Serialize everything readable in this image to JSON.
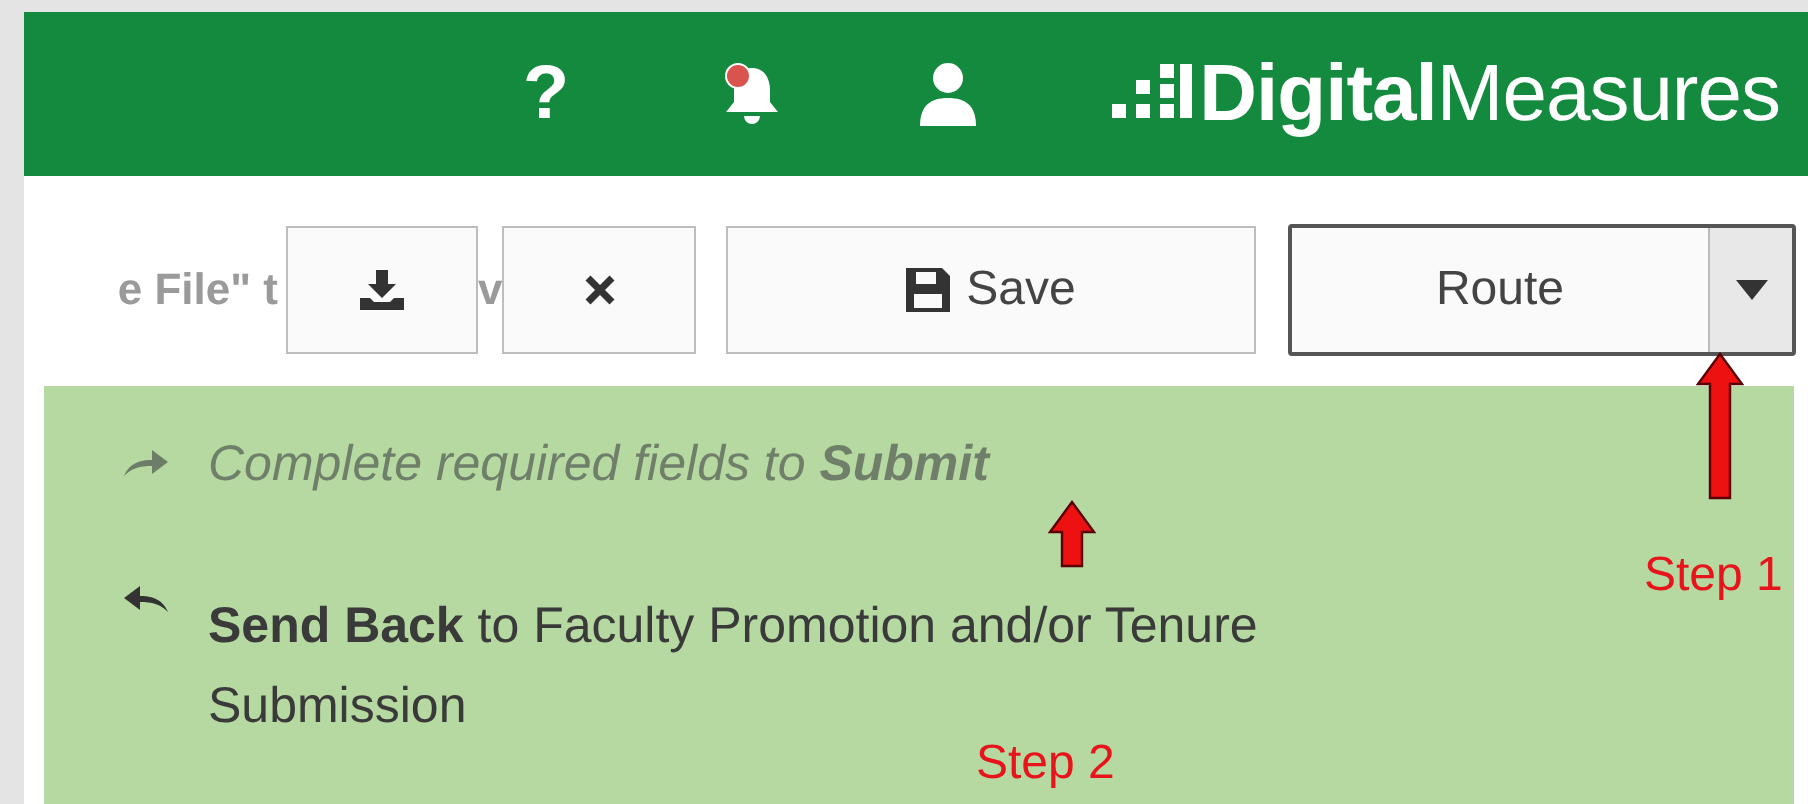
{
  "header": {
    "help": "?",
    "notification": true,
    "logo": "**Digital**Measures"
  },
  "toolbar": {
    "background_text": [
      "e File\" t",
      "v"
    ],
    "buttons": [
      {
        "kind": "download"
      },
      {
        "kind": "close"
      },
      {
        "kind": "save",
        "label": "Save"
      },
      {
        "kind": "route",
        "label": "Route",
        "expanded": true
      }
    ]
  },
  "menu": [
    {
      "kind": "forward",
      "text": "Complete required fields to **Submit**",
      "disabled": true
    },
    {
      "kind": "back",
      "text": "**Send Back** to Faculty Promotion and/or Tenure Submission",
      "disabled": false
    }
  ],
  "annotations": [
    {
      "kind": "step1",
      "label": "Step 1"
    },
    {
      "kind": "step2",
      "label": "Step 2"
    }
  ]
}
